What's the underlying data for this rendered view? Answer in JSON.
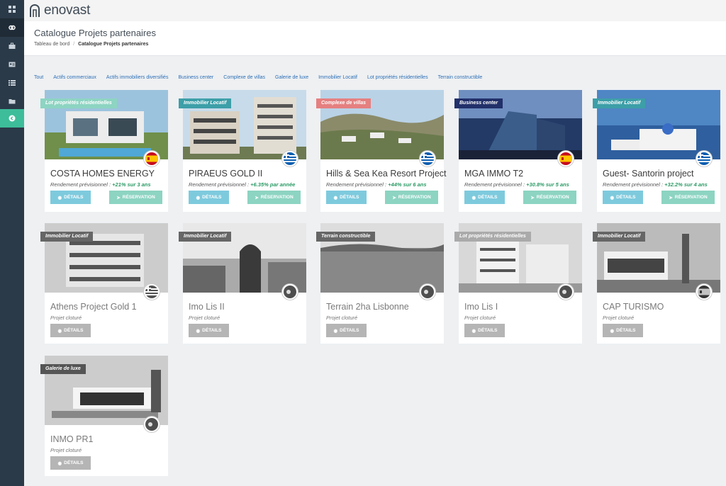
{
  "brand": {
    "name": "enovast"
  },
  "header": {
    "title": "Catalogue Projets partenaires",
    "breadcrumb": [
      "Tableau de bord",
      "Catalogue Projets partenaires"
    ]
  },
  "filters": [
    "Tout",
    "Actifs commerciaux",
    "Actifs immobiliers diversifiés",
    "Business center",
    "Complexe de villas",
    "Galerie de luxe",
    "Immobilier Locatif",
    "Lot propriétés résidentielles",
    "Terrain constructible"
  ],
  "labels": {
    "details": "DÉTAILS",
    "reservation": "RÉSERVATION",
    "yield_prefix": "Rendement prévisionnel : "
  },
  "projects": [
    {
      "name": "COSTA HOMES ENERGY",
      "category": "Lot propriétés résidentielles",
      "badge_color": "#8dd4c2",
      "yield": "+21% sur 3 ans",
      "flag": "spain",
      "status": "open"
    },
    {
      "name": "PIRAEUS GOLD II",
      "category": "Immobilier Locatif",
      "badge_color": "#3d9fa8",
      "yield": "+6.35% par année",
      "flag": "greece",
      "status": "open"
    },
    {
      "name": "Hills & Sea Kea Resort Project",
      "category": "Complexe de villas",
      "badge_color": "#e58080",
      "yield": "+44% sur 6 ans",
      "flag": "greece",
      "status": "open"
    },
    {
      "name": "MGA IMMO T2",
      "category": "Business center",
      "badge_color": "#22306a",
      "yield": "+30.8% sur 5 ans",
      "flag": "spain",
      "status": "open"
    },
    {
      "name": "Guest- Santorin project",
      "category": "Immobilier Locatif",
      "badge_color": "#3d9fa8",
      "yield": "+32.2% sur 4 ans",
      "flag": "greece",
      "status": "open"
    },
    {
      "name": "Athens Project Gold 1",
      "category": "Immobilier Locatif",
      "badge_color": "#666666",
      "status_text": "Projet cloturé",
      "flag": "greece",
      "status": "closed"
    },
    {
      "name": "Imo Lis II",
      "category": "Immobilier Locatif",
      "badge_color": "#666666",
      "status_text": "Projet cloturé",
      "flag": "portugal",
      "status": "closed"
    },
    {
      "name": "Terrain 2ha Lisbonne",
      "category": "Terrain constructible",
      "badge_color": "#666666",
      "status_text": "Projet cloturé",
      "flag": "portugal",
      "status": "closed"
    },
    {
      "name": "Imo Lis I",
      "category": "Lot propriétés résidentielles",
      "badge_color": "#aaaaaa",
      "status_text": "Projet cloturé",
      "flag": "portugal",
      "status": "closed"
    },
    {
      "name": "CAP TURISMO",
      "category": "Immobilier Locatif",
      "badge_color": "#666666",
      "status_text": "Projet cloturé",
      "flag": "spain",
      "status": "closed"
    },
    {
      "name": "INMO PR1",
      "category": "Galerie de luxe",
      "badge_color": "#555555",
      "status_text": "Projet cloturé",
      "flag": "portugal",
      "status": "closed"
    }
  ],
  "sidebar": {
    "icons": [
      "dashboard-icon",
      "handshake-icon",
      "briefcase-icon",
      "id-card-icon",
      "list-icon",
      "folder-icon",
      "back-arrow-icon"
    ]
  }
}
